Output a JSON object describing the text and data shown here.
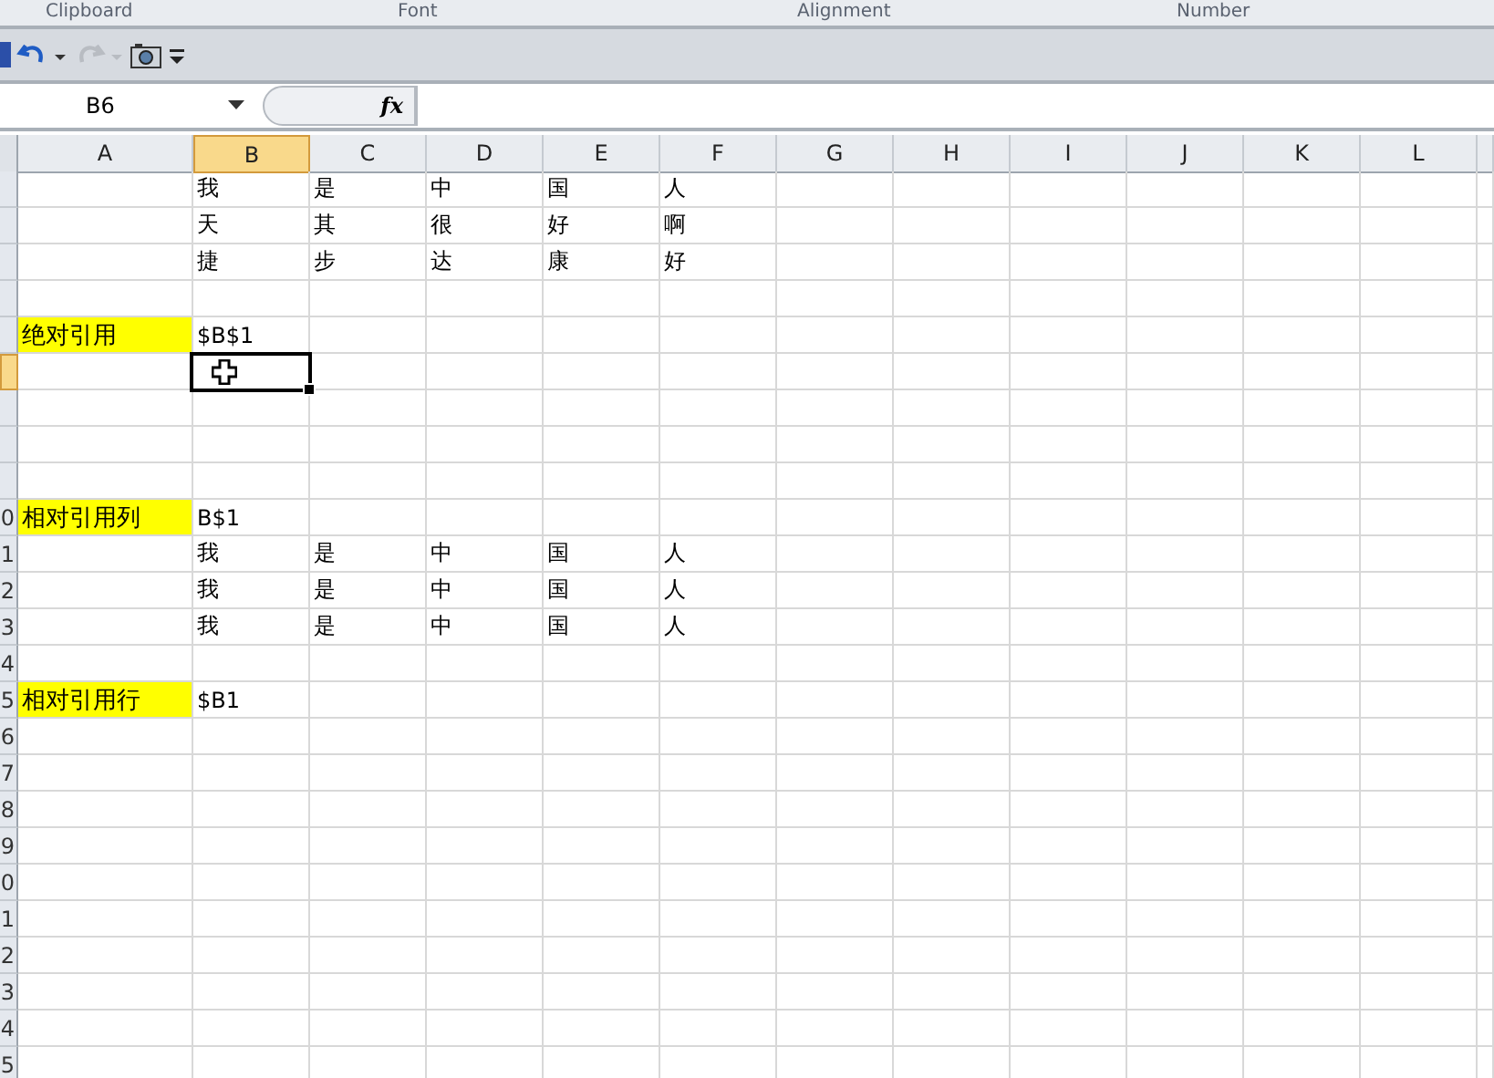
{
  "ribbon_groups": [
    {
      "label": "Clipboard"
    },
    {
      "label": "Font"
    },
    {
      "label": "Alignment"
    },
    {
      "label": "Number"
    }
  ],
  "quick_access_toolbar": {
    "redo_disabled": true
  },
  "name_box": {
    "value": "B6"
  },
  "formula_bar": {
    "fx": "fx"
  },
  "columns": [
    {
      "label": "A",
      "selected": false
    },
    {
      "label": "B",
      "selected": true
    },
    {
      "label": "C",
      "selected": false
    },
    {
      "label": "D",
      "selected": false
    },
    {
      "label": "E",
      "selected": false
    },
    {
      "label": "F",
      "selected": false
    },
    {
      "label": "G",
      "selected": false
    },
    {
      "label": "H",
      "selected": false
    },
    {
      "label": "I",
      "selected": false
    },
    {
      "label": "J",
      "selected": false
    },
    {
      "label": "K",
      "selected": false
    },
    {
      "label": "L",
      "selected": false
    }
  ],
  "rows": [
    {
      "selected": false,
      "cells": [
        {},
        {
          "text": "我"
        },
        {
          "text": "是"
        },
        {
          "text": "中"
        },
        {
          "text": "国"
        },
        {
          "text": "人"
        }
      ]
    },
    {
      "selected": false,
      "cells": [
        {},
        {
          "text": "天"
        },
        {
          "text": "其"
        },
        {
          "text": "很"
        },
        {
          "text": "好"
        },
        {
          "text": "啊"
        }
      ]
    },
    {
      "selected": false,
      "cells": [
        {},
        {
          "text": "捷"
        },
        {
          "text": "步"
        },
        {
          "text": "达"
        },
        {
          "text": "康"
        },
        {
          "text": "好"
        }
      ]
    },
    {
      "selected": false
    },
    {
      "selected": false,
      "cells": [
        {
          "text": "绝对引用",
          "highlighted": true
        },
        {
          "text": "$B$1"
        }
      ]
    },
    {
      "selected": true
    },
    {
      "selected": false
    },
    {
      "selected": false
    },
    {
      "selected": false
    },
    {
      "header": "0",
      "selected": false,
      "cells": [
        {
          "text": "相对引用列",
          "highlighted": true
        },
        {
          "text": "B$1"
        }
      ]
    },
    {
      "header": "1",
      "selected": false,
      "cells": [
        {},
        {
          "text": "我"
        },
        {
          "text": "是"
        },
        {
          "text": "中"
        },
        {
          "text": "国"
        },
        {
          "text": "人"
        }
      ]
    },
    {
      "header": "2",
      "selected": false,
      "cells": [
        {},
        {
          "text": "我"
        },
        {
          "text": "是"
        },
        {
          "text": "中"
        },
        {
          "text": "国"
        },
        {
          "text": "人"
        }
      ]
    },
    {
      "header": "3",
      "selected": false,
      "cells": [
        {},
        {
          "text": "我"
        },
        {
          "text": "是"
        },
        {
          "text": "中"
        },
        {
          "text": "国"
        },
        {
          "text": "人"
        }
      ]
    },
    {
      "header": "4",
      "selected": false
    },
    {
      "header": "5",
      "selected": false,
      "cells": [
        {
          "text": "相对引用行",
          "highlighted": true
        },
        {
          "text": "$B1"
        }
      ]
    },
    {
      "header": "6",
      "selected": false
    },
    {
      "header": "7",
      "selected": false
    },
    {
      "header": "8",
      "selected": false
    },
    {
      "header": "9",
      "selected": false
    },
    {
      "header": "0",
      "selected": false
    },
    {
      "header": "1",
      "selected": false
    },
    {
      "header": "2",
      "selected": false
    },
    {
      "header": "3",
      "selected": false
    },
    {
      "header": "4",
      "selected": false
    },
    {
      "header": "5",
      "selected": false
    }
  ]
}
